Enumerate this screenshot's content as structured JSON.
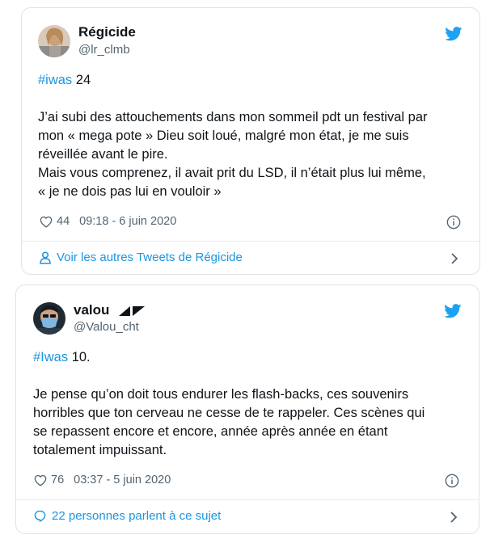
{
  "tweets": [
    {
      "name": "Régicide",
      "handle": "@lr_clmb",
      "hashtag": "#iwas",
      "number": " 24",
      "text_lines": [
        "J’ai subi des attouchements dans mon sommeil pdt un festival par",
        "mon « mega pote » Dieu soit loué, malgré mon état, je me suis",
        "réveillée avant le pire.",
        "Mais vous comprenez, il avait prit du LSD, il n’était plus lui même,",
        "« je ne dois pas lui en vouloir »"
      ],
      "likes": "44",
      "timestamp": "09:18 - 6 juin 2020",
      "footer_label": "Voir les autres Tweets de Régicide",
      "footer_icon": "person-icon"
    },
    {
      "name": "valou",
      "name_glyphs": "◢◤",
      "handle": "@Valou_cht",
      "hashtag": "#Iwas",
      "number": " 10.",
      "text_lines": [
        "Je pense qu’on doit tous endurer les flash-backs, ces souvenirs",
        "horribles que ton cerveau ne cesse de te rappeler. Ces scènes qui",
        "se repassent encore et encore, année après année en étant",
        "totalement impuissant."
      ],
      "likes": "76",
      "timestamp": "03:37 - 5 juin 2020",
      "footer_label": "22 personnes parlent à ce sujet",
      "footer_icon": "speech-bubble-icon"
    }
  ],
  "colors": {
    "link": "#1b95e0",
    "muted": "#536471",
    "border": "#dfe3e6"
  }
}
